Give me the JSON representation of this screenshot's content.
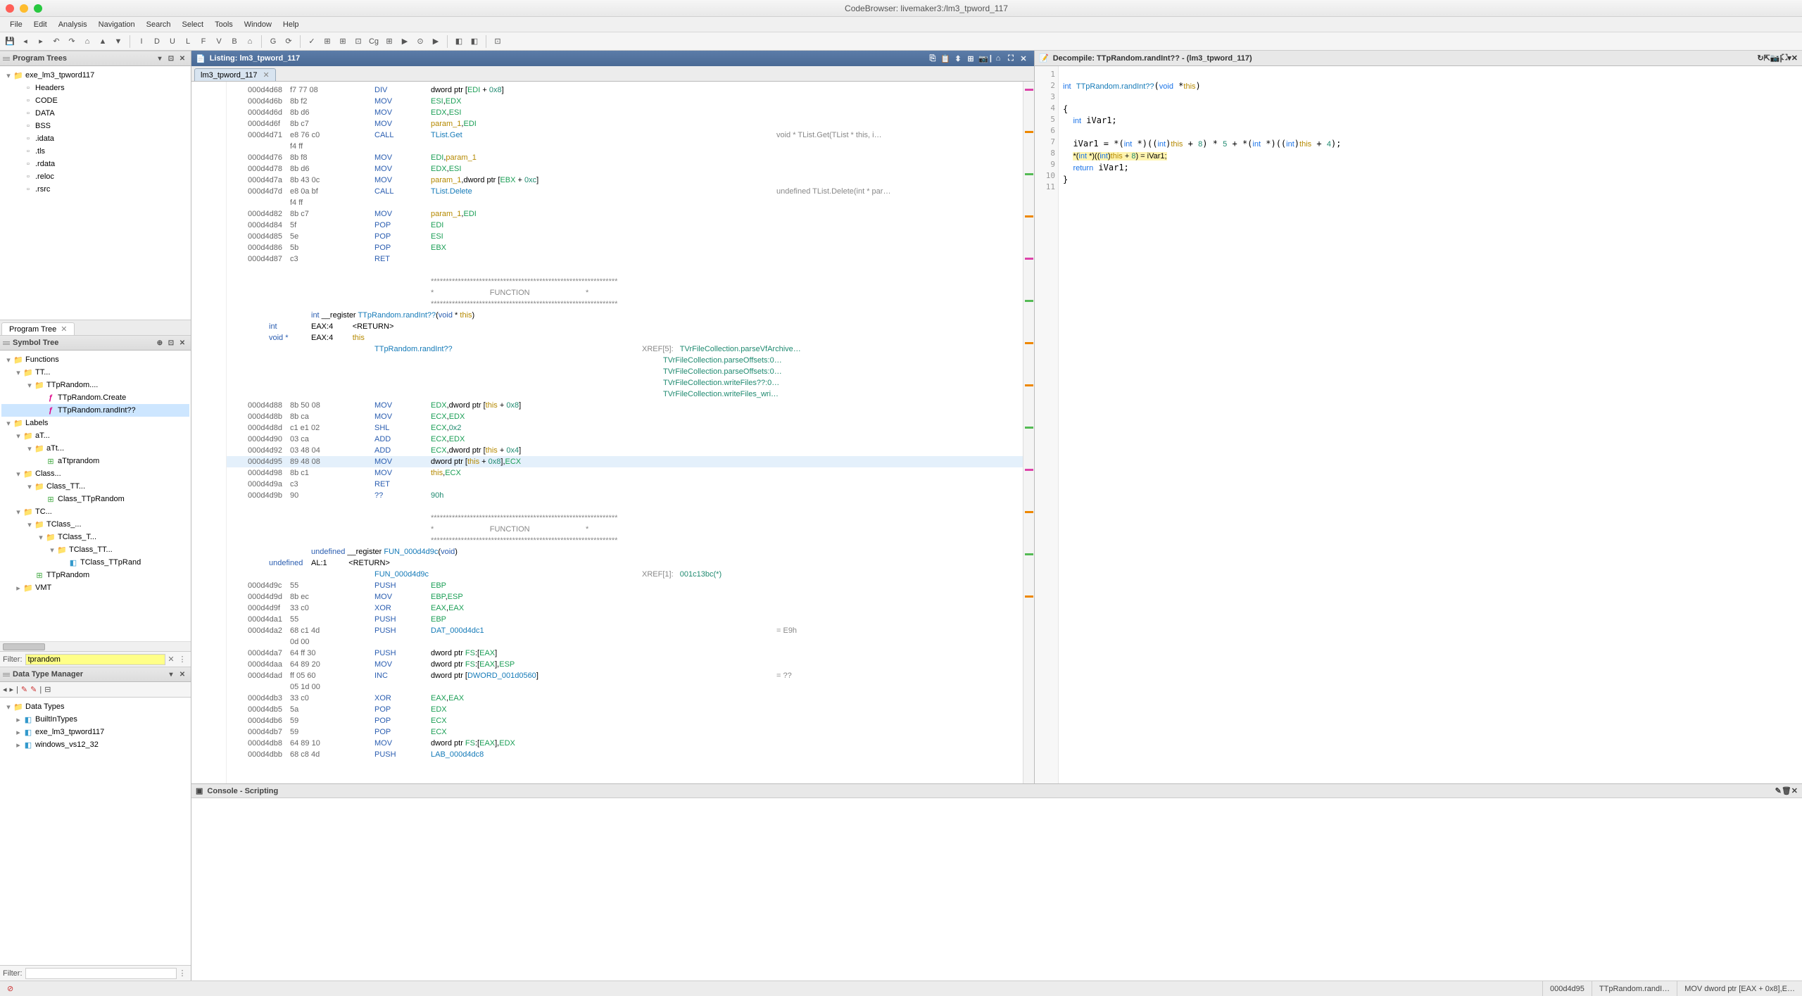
{
  "window": {
    "title": "CodeBrowser: livemaker3:/lm3_tpword_117"
  },
  "menu": [
    "File",
    "Edit",
    "Analysis",
    "Navigation",
    "Search",
    "Select",
    "Tools",
    "Window",
    "Help"
  ],
  "toolbar_icons": [
    "save",
    "back",
    "fwd",
    "undo",
    "redo",
    "home",
    "up",
    "down",
    "|",
    "I",
    "D",
    "U",
    "L",
    "F",
    "V",
    "B",
    "⌂",
    "|",
    "G",
    "⟳",
    "|",
    "✓",
    "⊞",
    "⊞",
    "⊡",
    "Cg",
    "⊞",
    "▶",
    "⊙",
    "▶",
    "|",
    "◧",
    "◧",
    "|",
    "⊡"
  ],
  "program_trees": {
    "title": "Program Trees",
    "tab": "Program Tree",
    "root": "exe_lm3_tpword117",
    "items": [
      "Headers",
      "CODE",
      "DATA",
      "BSS",
      ".idata",
      ".tls",
      ".rdata",
      ".reloc",
      ".rsrc"
    ]
  },
  "symbol_tree": {
    "title": "Symbol Tree",
    "filter_label": "Filter:",
    "filter_value": "tprandom",
    "nodes": {
      "functions": "Functions",
      "tt": "TT...",
      "tprandom_ns": "TTpRandom....",
      "create": "TTpRandom.Create",
      "randint": "TTpRandom.randInt??",
      "labels": "Labels",
      "at": "aT...",
      "att": "aTt...",
      "atprandom": "aTtprandom",
      "class": "Class...",
      "class_tt": "Class_TT...",
      "class_ttprandom": "Class_TTpRandom",
      "tc": "TC...",
      "tclass": "TClass_...",
      "tclass_t": "TClass_T...",
      "tclass_tt": "TClass_TT...",
      "tclass_ttprand": "TClass_TTpRand",
      "ttprandom": "TTpRandom",
      "vmt": "VMT"
    }
  },
  "data_types": {
    "title": "Data Type Manager",
    "root": "Data Types",
    "items": [
      "BuiltInTypes",
      "exe_lm3_tpword117",
      "windows_vs12_32"
    ],
    "filter_label": "Filter:"
  },
  "listing": {
    "title": "Listing: lm3_tpword_117",
    "file_tab": "lm3_tpword_117",
    "rows": [
      {
        "a": "000d4d68",
        "b": "f7 77 08",
        "m": "DIV",
        "o": "dword ptr [<r>EDI</r> + <n>0x8</n>]"
      },
      {
        "a": "000d4d6b",
        "b": "8b f2",
        "m": "MOV",
        "o": "<r>ESI</r>,<r>EDX</r>"
      },
      {
        "a": "000d4d6d",
        "b": "8b d6",
        "m": "MOV",
        "o": "<r>EDX</r>,<r>ESI</r>"
      },
      {
        "a": "000d4d6f",
        "b": "8b c7",
        "m": "MOV",
        "o": "<p>param_1</p>,<r>EDI</r>"
      },
      {
        "a": "000d4d71",
        "b": "e8 76 c0",
        "m": "CALL",
        "o": "<f>TList.Get</f>",
        "c": "void * TList.Get(TList * this, i…"
      },
      {
        "a": "",
        "b": "f4 ff",
        "m": "",
        "o": ""
      },
      {
        "a": "000d4d76",
        "b": "8b f8",
        "m": "MOV",
        "o": "<r>EDI</r>,<p>param_1</p>"
      },
      {
        "a": "000d4d78",
        "b": "8b d6",
        "m": "MOV",
        "o": "<r>EDX</r>,<r>ESI</r>"
      },
      {
        "a": "000d4d7a",
        "b": "8b 43 0c",
        "m": "MOV",
        "o": "<p>param_1</p>,dword ptr [<r>EBX</r> + <n>0xc</n>]"
      },
      {
        "a": "000d4d7d",
        "b": "e8 0a bf",
        "m": "CALL",
        "o": "<f>TList.Delete</f>",
        "c": "undefined TList.Delete(int * par…"
      },
      {
        "a": "",
        "b": "f4 ff",
        "m": "",
        "o": ""
      },
      {
        "a": "000d4d82",
        "b": "8b c7",
        "m": "MOV",
        "o": "<p>param_1</p>,<r>EDI</r>"
      },
      {
        "a": "000d4d84",
        "b": "5f",
        "m": "POP",
        "o": "<r>EDI</r>"
      },
      {
        "a": "000d4d85",
        "b": "5e",
        "m": "POP",
        "o": "<r>ESI</r>"
      },
      {
        "a": "000d4d86",
        "b": "5b",
        "m": "POP",
        "o": "<r>EBX</r>"
      },
      {
        "a": "000d4d87",
        "b": "c3",
        "m": "RET",
        "o": ""
      }
    ],
    "fn_header": {
      "stars": "**************************************************************",
      "fn_line": "*                          FUNCTION                          *",
      "sig": "int __register TTpRandom.randInt??(void * this)",
      "ret": "int           EAX:4          <RETURN>",
      "arg": "void *        EAX:4          this",
      "name": "TTpRandom.randInt??",
      "xref_label": "XREF[5]:",
      "xrefs": [
        "TVrFileCollection.parseVfArchive…",
        "TVrFileCollection.parseOffsets:0…",
        "TVrFileCollection.parseOffsets:0…",
        "TVrFileCollection.writeFiles??:0…",
        "TVrFileCollection.writeFiles_wri…"
      ]
    },
    "rows2": [
      {
        "a": "000d4d88",
        "b": "8b 50 08",
        "m": "MOV",
        "o": "<r>EDX</r>,dword ptr [<p>this</p> + <n>0x8</n>]"
      },
      {
        "a": "000d4d8b",
        "b": "8b ca",
        "m": "MOV",
        "o": "<r>ECX</r>,<r>EDX</r>"
      },
      {
        "a": "000d4d8d",
        "b": "c1 e1 02",
        "m": "SHL",
        "o": "<r>ECX</r>,<n>0x2</n>"
      },
      {
        "a": "000d4d90",
        "b": "03 ca",
        "m": "ADD",
        "o": "<r>ECX</r>,<r>EDX</r>"
      },
      {
        "a": "000d4d92",
        "b": "03 48 04",
        "m": "ADD",
        "o": "<r>ECX</r>,dword ptr [<p>this</p> + <n>0x4</n>]"
      },
      {
        "a": "000d4d95",
        "b": "89 48 08",
        "m": "MOV",
        "o": "dword ptr [<p>this</p> + <n>0x8</n>],<r>ECX</r>",
        "hl": true
      },
      {
        "a": "000d4d98",
        "b": "8b c1",
        "m": "MOV",
        "o": "<p>this</p>,<r>ECX</r>"
      },
      {
        "a": "000d4d9a",
        "b": "c3",
        "m": "RET",
        "o": ""
      },
      {
        "a": "000d4d9b",
        "b": "90",
        "m": "??",
        "o": "<n>90h</n>"
      }
    ],
    "fn_header2": {
      "sig": "undefined __register FUN_000d4d9c(void)",
      "ret": "undefined     AL:1           <RETURN>",
      "name": "FUN_000d4d9c",
      "xref_label": "XREF[1]:",
      "xref": "001c13bc(*)"
    },
    "rows3": [
      {
        "a": "000d4d9c",
        "b": "55",
        "m": "PUSH",
        "o": "<r>EBP</r>"
      },
      {
        "a": "000d4d9d",
        "b": "8b ec",
        "m": "MOV",
        "o": "<r>EBP</r>,<r>ESP</r>"
      },
      {
        "a": "000d4d9f",
        "b": "33 c0",
        "m": "XOR",
        "o": "<r>EAX</r>,<r>EAX</r>"
      },
      {
        "a": "000d4da1",
        "b": "55",
        "m": "PUSH",
        "o": "<r>EBP</r>"
      },
      {
        "a": "000d4da2",
        "b": "68 c1 4d",
        "m": "PUSH",
        "o": "<f>DAT_000d4dc1</f>",
        "c": "= E9h"
      },
      {
        "a": "",
        "b": "0d 00",
        "m": "",
        "o": ""
      },
      {
        "a": "000d4da7",
        "b": "64 ff 30",
        "m": "PUSH",
        "o": "dword ptr <r>FS</r>:[<r>EAX</r>]"
      },
      {
        "a": "000d4daa",
        "b": "64 89 20",
        "m": "MOV",
        "o": "dword ptr <r>FS</r>:[<r>EAX</r>],<r>ESP</r>"
      },
      {
        "a": "000d4dad",
        "b": "ff 05 60",
        "m": "INC",
        "o": "dword ptr [<f>DWORD_001d0560</f>]",
        "c": "= ??"
      },
      {
        "a": "",
        "b": "05 1d 00",
        "m": "",
        "o": ""
      },
      {
        "a": "000d4db3",
        "b": "33 c0",
        "m": "XOR",
        "o": "<r>EAX</r>,<r>EAX</r>"
      },
      {
        "a": "000d4db5",
        "b": "5a",
        "m": "POP",
        "o": "<r>EDX</r>"
      },
      {
        "a": "000d4db6",
        "b": "59",
        "m": "POP",
        "o": "<r>ECX</r>"
      },
      {
        "a": "000d4db7",
        "b": "59",
        "m": "POP",
        "o": "<r>ECX</r>"
      },
      {
        "a": "000d4db8",
        "b": "64 89 10",
        "m": "MOV",
        "o": "dword ptr <r>FS</r>:[<r>EAX</r>],<r>EDX</r>"
      },
      {
        "a": "000d4dbb",
        "b": "68 c8 4d",
        "m": "PUSH",
        "o": "<f>LAB_000d4dc8</f>"
      }
    ]
  },
  "decompile": {
    "title": "Decompile: TTpRandom.randInt?? - (lm3_tpword_117)",
    "lines": [
      "",
      "<t>int</t> <f>TTpRandom.randInt??</f>(<t>void</t> *<p>this</p>)",
      "",
      "{",
      "  <t>int</t> iVar1;",
      "",
      "  iVar1 = *(<t>int</t> *)((<t>int</t>)<p>this</p> + <n>8</n>) * <n>5</n> + *(<t>int</t> *)((<t>int</t>)<p>this</p> + <n>4</n>);",
      "  <sel>*(<t>int</t> *)((<t>int</t>)<p>this</p> + <n>8</n>) = iVar1;</sel>",
      "  <k>return</k> iVar1;",
      "}",
      ""
    ]
  },
  "console": {
    "title": "Console - Scripting"
  },
  "status": {
    "addr": "000d4d95",
    "fn": "TTpRandom.randI…",
    "inst": "MOV dword ptr [EAX + 0x8],E…"
  }
}
